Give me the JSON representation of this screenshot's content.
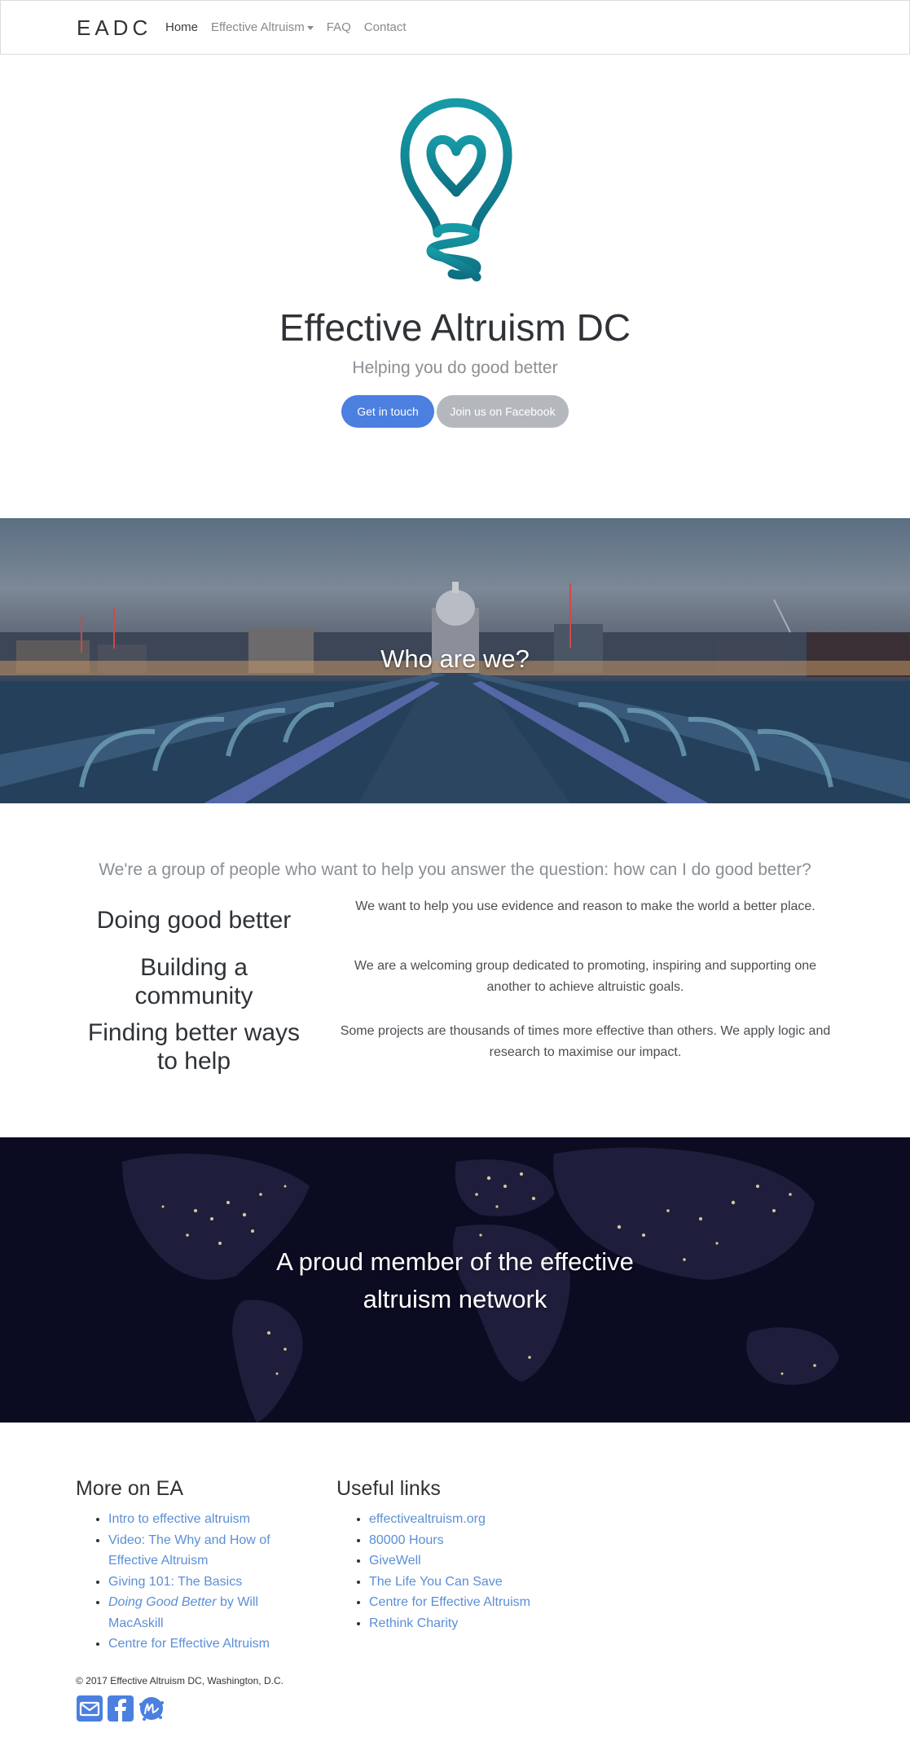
{
  "nav": {
    "brand": "EADC",
    "items": [
      {
        "label": "Home"
      },
      {
        "label": "Effective Altruism"
      },
      {
        "label": "FAQ"
      },
      {
        "label": "Contact"
      }
    ]
  },
  "hero": {
    "logo_icon": "lightbulb-heart-icon",
    "title": "Effective Altruism DC",
    "subtitle": "Helping you do good better",
    "primary_button": "Get in touch",
    "secondary_button": "Join us on Facebook"
  },
  "banner_who": {
    "title": "Who are we?"
  },
  "about": {
    "lead": "We're a group of people who want to help you answer the question: how can I do good better?",
    "rows": [
      {
        "heading": "Doing good better",
        "text": "We want to help you use evidence and reason to make the world a better place."
      },
      {
        "heading": "Building a community",
        "text": "We are a welcoming group dedicated to promoting, inspiring and supporting one another to achieve altruistic goals."
      },
      {
        "heading": "Finding better ways to help",
        "text": "Some projects are thousands of times more effective than others. We apply logic and research to maximise our impact."
      }
    ]
  },
  "banner_network": {
    "title": "A proud member of the effective altruism network"
  },
  "footer": {
    "more_on_ea": {
      "heading": "More on EA",
      "links": [
        {
          "label": "Intro to effective altruism"
        },
        {
          "prefix": "Video:",
          "label": "The Why and How of Effective Altruism"
        },
        {
          "label": "Giving 101: The Basics"
        },
        {
          "italic": "Doing Good Better",
          "suffix": "by Will MacAskill"
        },
        {
          "label": "Centre for Effective Altruism"
        }
      ]
    },
    "useful_links": {
      "heading": "Useful links",
      "links": [
        {
          "label": "effectivealtruism.org"
        },
        {
          "label": "80000 Hours"
        },
        {
          "label": "GiveWell"
        },
        {
          "label": "The Life You Can Save"
        },
        {
          "label": "Centre for Effective Altruism"
        },
        {
          "label": "Rethink Charity"
        }
      ]
    },
    "copyright": "© 2017 Effective Altruism DC, Washington, D.C.",
    "social_icons": [
      "email-icon",
      "facebook-icon",
      "meetup-icon"
    ]
  },
  "colors": {
    "accent": "#4b7fe0",
    "secondary": "#b4b8bd",
    "link": "#5b8fd6",
    "logo_teal": "#128a99"
  }
}
